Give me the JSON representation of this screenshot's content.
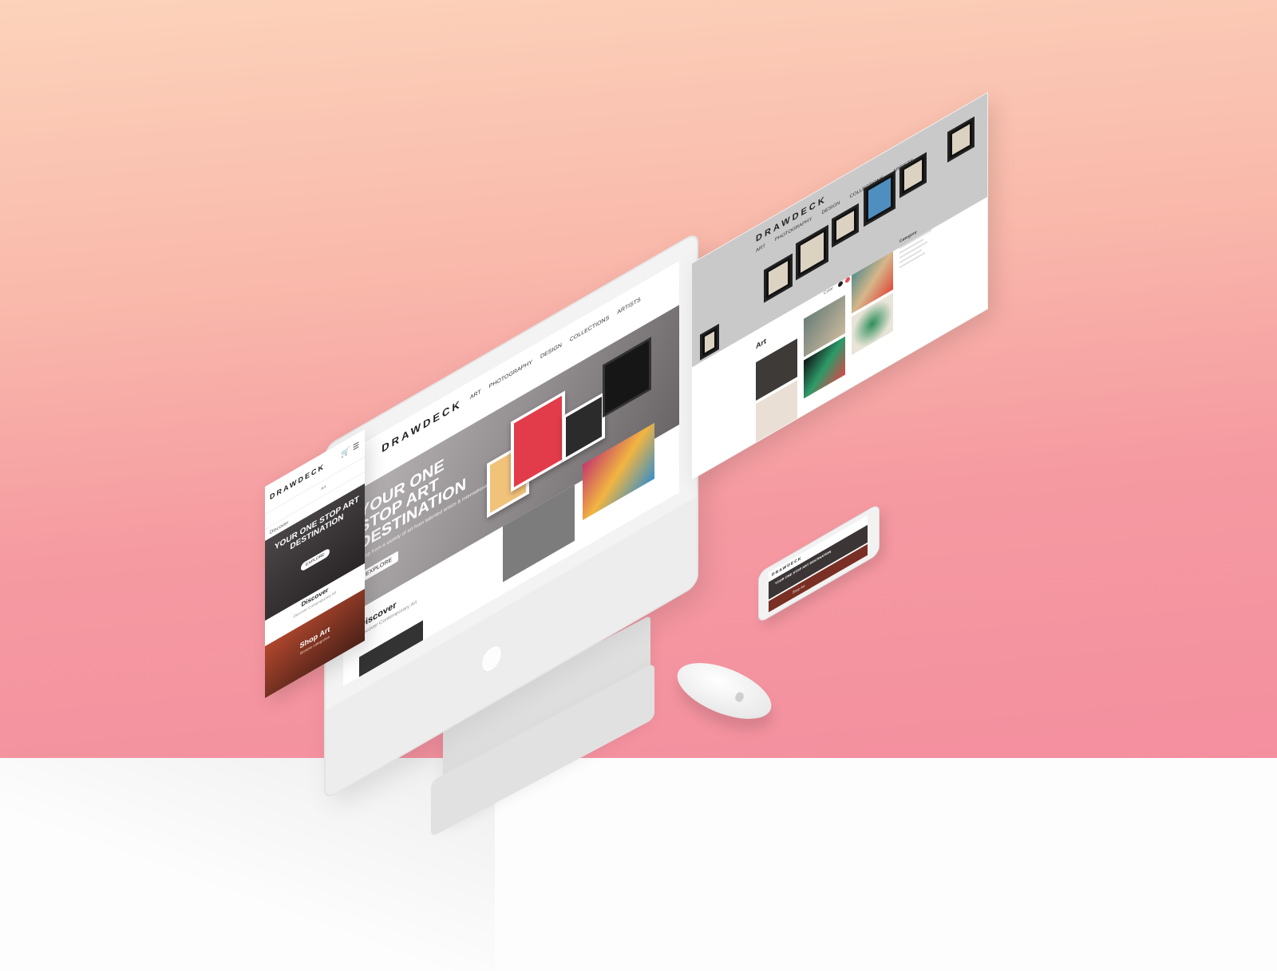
{
  "scene": {
    "background_top": "#fcd3bb",
    "background_bottom": "#f48f9f",
    "floor": "#fdfdfd"
  },
  "desktop_site": {
    "logo": "DRAWDECK",
    "nav": [
      "ART",
      "PHOTOGRAPHY",
      "DESIGN",
      "COLLECTIONS",
      "ARTISTS"
    ],
    "hero_title": "YOUR ONE STOP ART DESTINATION",
    "hero_sub": "Shop from a variety of art from talented artists & international brands",
    "hero_button": "EXPLORE",
    "discover_title": "Discover",
    "discover_sub": "Discover Contemporary Art"
  },
  "catalog_site": {
    "logo": "DRAWDECK",
    "nav": [
      "ART",
      "PHOTOGRAPHY",
      "DESIGN",
      "COLLECTIONS",
      "ARTISTS"
    ],
    "section_title": "Art",
    "filter_label": "Color",
    "sidebar_title": "Category",
    "colors": [
      "#222222",
      "#e84b5a",
      "#3ba3d8",
      "#7b4fb3",
      "#f2c14e",
      "#4bb37a"
    ]
  },
  "mobile_site": {
    "logo": "DRAWDECK",
    "search_value": "Art",
    "discover_link": "Discover",
    "hero_title": "YOUR ONE STOP ART DESTINATION",
    "hero_button": "EXPLORE",
    "discover_title": "Discover",
    "discover_sub": "Discover Contemporary Art",
    "shop_title": "Shop Art",
    "shop_sub": "Browse categories"
  },
  "phone_site": {
    "logo": "DRAWDECK",
    "hero_title": "YOUR ONE STOP ART DESTINATION",
    "shop_title": "Shop Art"
  }
}
